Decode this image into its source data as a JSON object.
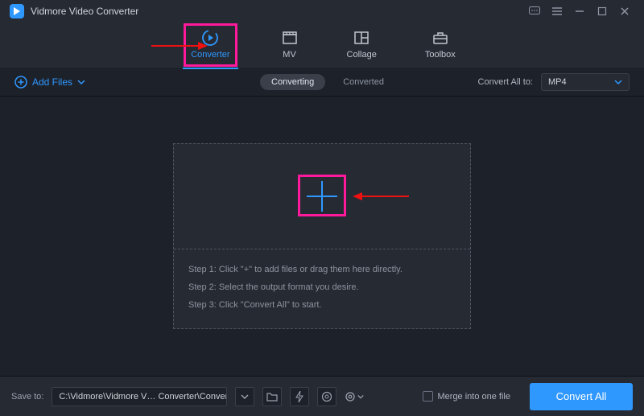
{
  "app": {
    "title": "Vidmore Video Converter",
    "icon_name": "app-logo"
  },
  "window_controls": [
    "feedback-icon",
    "menu-icon",
    "minimize-icon",
    "maximize-icon",
    "close-icon"
  ],
  "main_tabs": [
    {
      "id": "converter",
      "label": "Converter",
      "icon": "spinner-play-icon",
      "active": true,
      "highlighted": true
    },
    {
      "id": "mv",
      "label": "MV",
      "icon": "clapperboard-icon",
      "active": false,
      "highlighted": false
    },
    {
      "id": "collage",
      "label": "Collage",
      "icon": "grid-icon",
      "active": false,
      "highlighted": false
    },
    {
      "id": "toolbox",
      "label": "Toolbox",
      "icon": "toolbox-icon",
      "active": false,
      "highlighted": false
    }
  ],
  "toolbar": {
    "add_files_label": "Add Files",
    "sub_tabs": {
      "converting": "Converting",
      "converted": "Converted",
      "active": "converting"
    },
    "convert_all_to_label": "Convert All to:",
    "format_selected": "MP4"
  },
  "dropzone": {
    "plus_highlighted": true,
    "steps": [
      "Step 1: Click \"+\" to add files or drag them here directly.",
      "Step 2: Select the output format you desire.",
      "Step 3: Click \"Convert All\" to start."
    ]
  },
  "footer": {
    "save_to_label": "Save to:",
    "save_to_path": "C:\\Vidmore\\Vidmore V… Converter\\Converted",
    "merge_label": "Merge into one file",
    "convert_all_label": "Convert All"
  },
  "annotations": {
    "arrow_to_converter": true,
    "arrow_to_plus": true
  },
  "colors": {
    "accent": "#2f98ff",
    "highlight": "#ff1a9c",
    "bg": "#1d2129",
    "panel": "#262a33"
  }
}
